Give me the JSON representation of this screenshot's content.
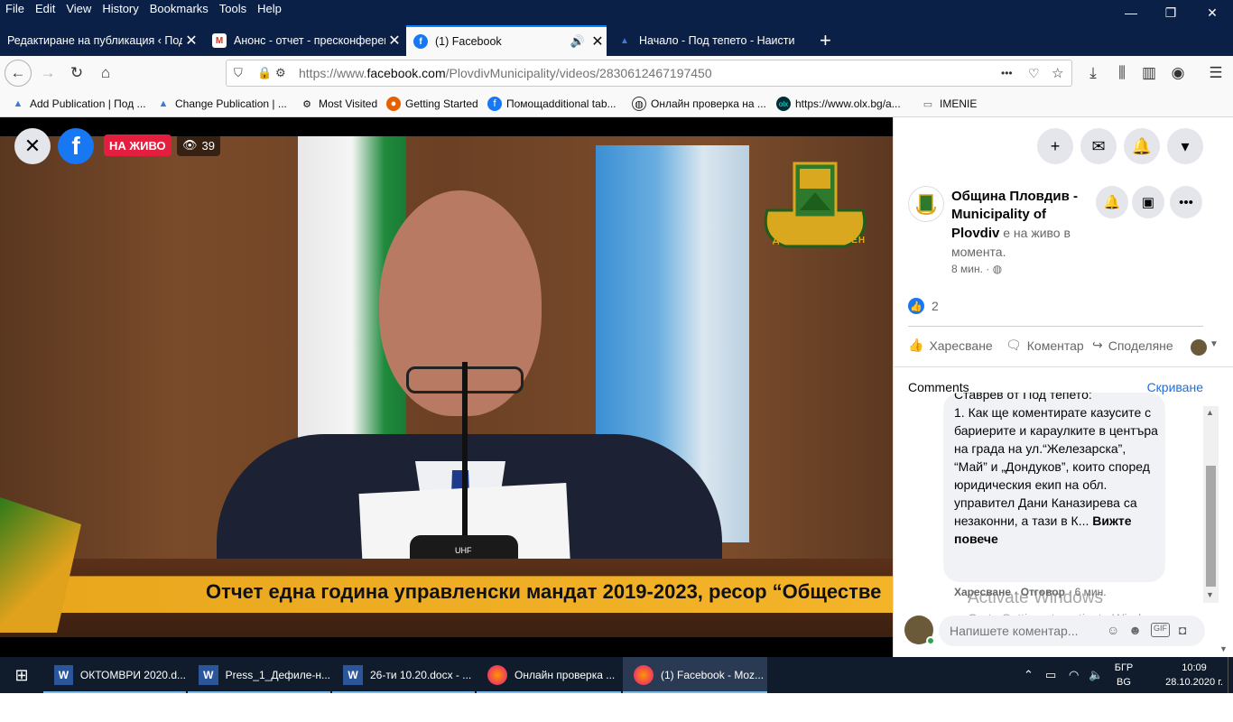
{
  "menu": [
    "File",
    "Edit",
    "View",
    "History",
    "Bookmarks",
    "Tools",
    "Help"
  ],
  "window_controls": {
    "minimize": "—",
    "restore": "❐",
    "close": "✕"
  },
  "tabs": [
    {
      "title": "Редактиране на публикация ‹ Под",
      "close": "✕"
    },
    {
      "title": "Анонс - отчет - пресконферен",
      "close": "✕"
    },
    {
      "title": "(1) Facebook",
      "close": "✕"
    },
    {
      "title": "Начало - Под тепето - Наисти",
      "close": ""
    }
  ],
  "new_tab": "+",
  "nav": {
    "back": "←",
    "forward": "→",
    "reload": "↻",
    "home": "⌂",
    "url_prefix": "https://www.",
    "url_domain": "facebook.com",
    "url_path": "/PlovdivMunicipality/videos/2830612467197450",
    "more": "•••"
  },
  "bookmarks": [
    "Add Publication | Под ...",
    "Change Publication | ...",
    "Most Visited",
    "Getting Started",
    "Помощadditional tab...",
    "Онлайн проверка на ...",
    "https://www.olx.bg/a...",
    "IMENIE"
  ],
  "video": {
    "live_label": "НА ЖИВО",
    "viewers": "39",
    "banner": "Отчет една година управленски мандат 2019-2023, ресор “Обществе",
    "crest_motto": "ДРЕВЕН И ВЕЧЕН",
    "mic_brand": "UHF"
  },
  "panel": {
    "notification_count": "1",
    "page_name": "Община Пловдив - Municipality of Plovdiv",
    "live_status": " е на живо в момента.",
    "post_time": "8 мин. · ",
    "like_count": "2",
    "actions": {
      "like": "Харесване",
      "comment": "Коментар",
      "share": "Споделяне"
    },
    "comments_title": "Comments",
    "hide_label": "Скриване",
    "comment_cutoff": "Ставрев от Под тепето:",
    "comment_body": "1. Как ще коментирате казусите с бариерите и караулките в центъра на града на ул.“Железарска”, “Май” и „Дондуков”, които според юридическия екип на обл. управител Дани Каназирева са незаконни, а тази в К...",
    "see_more": "Вижте повече",
    "comment_like": "Харесване",
    "comment_reply": "Отговор",
    "comment_time": "6 мин.",
    "watermark_title": "Activate Windows",
    "watermark_sub": "Go to Settings to activate Windows.",
    "write_placeholder": "Напишете коментар..."
  },
  "taskbar": {
    "items": [
      {
        "label": "ОКТОМВРИ 2020.d...",
        "icon": "W"
      },
      {
        "label": "Press_1_Дефиле-н...",
        "icon": "W"
      },
      {
        "label": "26-ти 10.20.docx - ...",
        "icon": "W"
      },
      {
        "label": "Онлайн проверка ...",
        "icon": "firefox"
      },
      {
        "label": "(1) Facebook - Moz...",
        "icon": "firefox"
      }
    ],
    "lang_top": "БГР",
    "lang_bottom": "BG",
    "time": "10:09",
    "date": "28.10.2020 г."
  },
  "colors": {
    "fb_blue": "#1877f2",
    "live_red": "#e41e3f",
    "firefox_dark": "#0b2047"
  }
}
